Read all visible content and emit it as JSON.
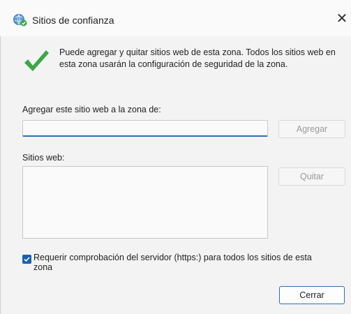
{
  "window": {
    "title": "Sitios de confianza",
    "close_icon": "close-icon",
    "title_icon": "globe-check-icon"
  },
  "info": {
    "icon": "checkmark-icon",
    "text": "Puede agregar y quitar sitios web de esta zona. Todos los sitios web en esta zona usarán la configuración de seguridad de la zona."
  },
  "add_site": {
    "label": "Agregar este sitio web a la zona de:",
    "value": "",
    "placeholder": "",
    "button_label": "Agregar"
  },
  "sites": {
    "label": "Sitios web:",
    "items": [],
    "remove_button_label": "Quitar"
  },
  "https": {
    "checked": true,
    "label": "Requerir comprobación del servidor (https:) para todos los sitios de esta zona"
  },
  "footer": {
    "close_button_label": "Cerrar"
  },
  "colors": {
    "accent": "#1a5fb4",
    "check_green": "#3aa845",
    "disabled_text": "#9a9a9a"
  }
}
